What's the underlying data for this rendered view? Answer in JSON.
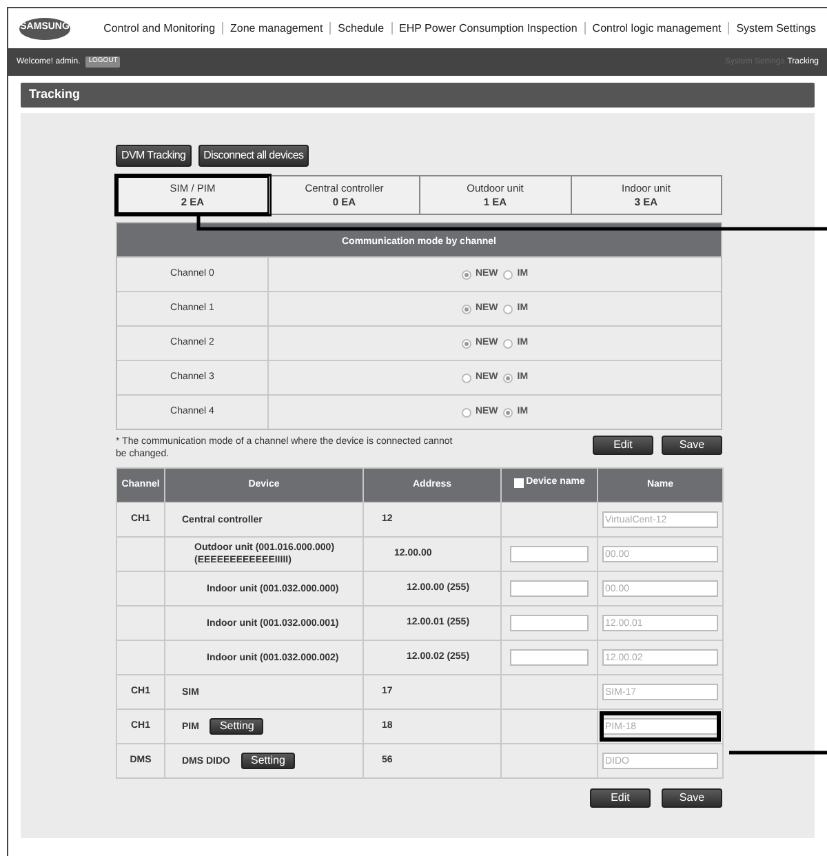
{
  "logo": "SAMSUNG",
  "nav": [
    "Control and Monitoring",
    "Zone management",
    "Schedule",
    "EHP Power Consumption Inspection",
    "Control logic management",
    "System Settings"
  ],
  "user_bar": {
    "welcome": "Welcome! admin.",
    "logout": "LOGOUT",
    "breadcrumb": [
      {
        "label": "System Settings",
        "current": false
      },
      {
        "label": "Tracking",
        "current": true
      }
    ]
  },
  "page_title": "Tracking",
  "actions": [
    "DVM Tracking",
    "Disconnect all devices"
  ],
  "tabs": [
    {
      "label": "SIM / PIM",
      "count": "2 EA",
      "callout": true
    },
    {
      "label": "Central controller",
      "count": "0 EA",
      "callout": false
    },
    {
      "label": "Outdoor unit",
      "count": "1 EA",
      "callout": false
    },
    {
      "label": "Indoor unit",
      "count": "3 EA",
      "callout": false
    }
  ],
  "channel_table": {
    "title": "Communication mode by channel",
    "channels": [
      {
        "label": "Channel 0",
        "options": [
          {
            "label": "NEW",
            "selected": true
          },
          {
            "label": "IM",
            "selected": false
          }
        ]
      },
      {
        "label": "Channel 1",
        "options": [
          {
            "label": "NEW",
            "selected": true
          },
          {
            "label": "IM",
            "selected": false
          }
        ]
      },
      {
        "label": "Channel 2",
        "options": [
          {
            "label": "NEW",
            "selected": true
          },
          {
            "label": "IM",
            "selected": false
          }
        ]
      },
      {
        "label": "Channel 3",
        "options": [
          {
            "label": "NEW",
            "selected": false
          },
          {
            "label": "IM",
            "selected": true
          }
        ]
      },
      {
        "label": "Channel 4",
        "options": [
          {
            "label": "NEW",
            "selected": false
          },
          {
            "label": "IM",
            "selected": true
          }
        ]
      }
    ]
  },
  "note": "* The communication mode of a channel where the device is connected cannot be changed.",
  "note_buttons": [
    "Edit",
    "Save"
  ],
  "device_table": {
    "columns": [
      {
        "label": "Channel",
        "checkbox": false
      },
      {
        "label": "Device",
        "checkbox": false
      },
      {
        "label": "Address",
        "checkbox": false
      },
      {
        "label": "Device name",
        "checkbox": true,
        "checked": false
      },
      {
        "label": "Name",
        "checkbox": false
      }
    ],
    "rows": [
      {
        "channel": "CH1",
        "device": [
          "Central controller"
        ],
        "address": "12",
        "device_name_field": false,
        "name": "VirtualCent-12",
        "callout": false,
        "children": [
          {
            "device": [
              "Outdoor unit (001.016.000.000)",
              "(EEEEEEEEEEEEIIIII)"
            ],
            "address": "12.00.00",
            "device_name_field": true,
            "name": "00.00",
            "callout": false,
            "children": [
              {
                "device": [
                  "Indoor unit (001.032.000.000)"
                ],
                "address": "12.00.00 (255)",
                "device_name_field": true,
                "name": "00.00",
                "callout": false
              },
              {
                "device": [
                  "Indoor unit (001.032.000.001)"
                ],
                "address": "12.00.01 (255)",
                "device_name_field": true,
                "name": "12.00.01",
                "callout": false
              },
              {
                "device": [
                  "Indoor unit (001.032.000.002)"
                ],
                "address": "12.00.02 (255)",
                "device_name_field": true,
                "name": "12.00.02",
                "callout": false
              }
            ]
          }
        ]
      },
      {
        "channel": "CH1",
        "device": [
          "SIM"
        ],
        "address": "17",
        "device_name_field": false,
        "name": "SIM-17",
        "callout": false
      },
      {
        "channel": "CH1",
        "device": [
          "PIM"
        ],
        "button": "Setting",
        "address": "18",
        "device_name_field": false,
        "name": "PIM-18",
        "callout": true
      },
      {
        "channel": "DMS",
        "device": [
          "DMS DIDO"
        ],
        "button": "Setting",
        "address": "56",
        "device_name_field": false,
        "name": "DIDO",
        "callout": false
      }
    ]
  },
  "bottom_buttons": [
    "Edit",
    "Save"
  ]
}
